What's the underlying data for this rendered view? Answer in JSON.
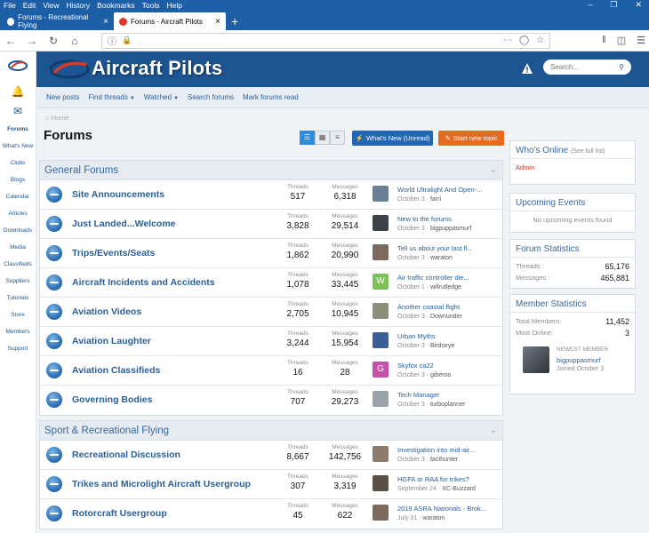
{
  "browser": {
    "menu": [
      "File",
      "Edit",
      "View",
      "History",
      "Bookmarks",
      "Tools",
      "Help"
    ],
    "tabs": [
      {
        "title": "Forums - Recreational Flying",
        "active": false
      },
      {
        "title": "Forums - Aircraft Pilots",
        "active": true
      }
    ]
  },
  "site": {
    "brand": "Aircraft Pilots",
    "search_placeholder": "Search...",
    "left_nav": [
      "Forums",
      "What's New",
      "Clubs",
      "Blogs",
      "Calendar",
      "Articles",
      "Downloads",
      "Media",
      "Classifieds",
      "Suppliers",
      "Tutorials",
      "Store",
      "Members",
      "Support"
    ],
    "subnav": [
      "New posts",
      "Find threads",
      "Watched",
      "Search forums",
      "Mark forums read"
    ],
    "breadcrumb": "Home",
    "page_title": "Forums",
    "whats_new_btn": "What's New (Unread)",
    "new_topic_btn": "Start new topic",
    "stat_labels": {
      "threads": "Threads",
      "messages": "Messages"
    }
  },
  "categories": [
    {
      "title": "General Forums",
      "nodes": [
        {
          "title": "Site Announcements",
          "threads": "517",
          "messages": "6,318",
          "lp_title": "World Ultralight And Open-...",
          "lp_date": "October 3",
          "lp_user": "farri",
          "avatar_color": "#6a7f93",
          "avatar_letter": ""
        },
        {
          "title": "Just Landed...Welcome",
          "threads": "3,828",
          "messages": "29,514",
          "lp_title": "New to the forums",
          "lp_date": "October 3",
          "lp_user": "bigpuppasmurf",
          "avatar_color": "#3c4248",
          "avatar_letter": ""
        },
        {
          "title": "Trips/Events/Seats",
          "threads": "1,862",
          "messages": "20,990",
          "lp_title": "Tell us about your last fl...",
          "lp_date": "October 3",
          "lp_user": "waraton",
          "avatar_color": "#7c6a5e",
          "avatar_letter": ""
        },
        {
          "title": "Aircraft Incidents and Accidents",
          "threads": "1,078",
          "messages": "33,445",
          "lp_title": "Air traffic controller die...",
          "lp_date": "October 1",
          "lp_user": "willrutledge",
          "avatar_color": "#7ec15a",
          "avatar_letter": "W"
        },
        {
          "title": "Aviation Videos",
          "threads": "2,705",
          "messages": "10,945",
          "lp_title": "Another coastal flight",
          "lp_date": "October 3",
          "lp_user": "Downunder",
          "avatar_color": "#8a8f7a",
          "avatar_letter": ""
        },
        {
          "title": "Aviation Laughter",
          "threads": "3,244",
          "messages": "15,954",
          "lp_title": "Urban Myths",
          "lp_date": "October 3",
          "lp_user": "Birdseye",
          "avatar_color": "#3b5e97",
          "avatar_letter": ""
        },
        {
          "title": "Aviation Classifieds",
          "threads": "16",
          "messages": "28",
          "lp_title": "Skyfox ca22",
          "lp_date": "October 3",
          "lp_user": "giberoo",
          "avatar_color": "#c452a8",
          "avatar_letter": "G"
        },
        {
          "title": "Governing Bodies",
          "threads": "707",
          "messages": "29,273",
          "lp_title": "Tech Manager",
          "lp_date": "October 3",
          "lp_user": "turboplanner",
          "avatar_color": "#9aa3ac",
          "avatar_letter": ""
        }
      ]
    },
    {
      "title": "Sport & Recreational Flying",
      "nodes": [
        {
          "title": "Recreational Discussion",
          "threads": "8,667",
          "messages": "142,756",
          "lp_title": "Investigation into mid-air...",
          "lp_date": "October 3",
          "lp_user": "facthunter",
          "avatar_color": "#8f7b6b",
          "avatar_letter": ""
        },
        {
          "title": "Trikes and Microlight Aircraft Usergroup",
          "threads": "307",
          "messages": "3,319",
          "lp_title": "HGFA or RAA for trikes?",
          "lp_date": "September 24",
          "lp_user": "XC-Buzzard",
          "avatar_color": "#5b4f44",
          "avatar_letter": ""
        },
        {
          "title": "Rotorcraft Usergroup",
          "threads": "45",
          "messages": "622",
          "lp_title": "2019 ASRA Nationals - Brok...",
          "lp_date": "July 31",
          "lp_user": "waraton",
          "avatar_color": "#7c6a5e",
          "avatar_letter": ""
        }
      ]
    }
  ],
  "sidebar": {
    "online": {
      "title": "Who's Online",
      "link": "(See full list)",
      "user": "Admin"
    },
    "events": {
      "title": "Upcoming Events",
      "empty": "No upcoming events found"
    },
    "forum_stats": {
      "title": "Forum Statistics",
      "threads_label": "Threads :",
      "threads": "65,176",
      "messages_label": "Messages :",
      "messages": "465,881"
    },
    "member_stats": {
      "title": "Member Statistics",
      "total_label": "Total Members:",
      "total": "11,452",
      "most_label": "Most Online:",
      "most": "3",
      "newest_label": "NEWEST MEMBER",
      "newest_user": "bigpuppasmurf",
      "newest_joined": "Joined October 3"
    }
  },
  "colors": {
    "brand": "#1d5592",
    "accent": "#2167b4",
    "new_topic": "#e9691e",
    "link": "#2a6099"
  }
}
